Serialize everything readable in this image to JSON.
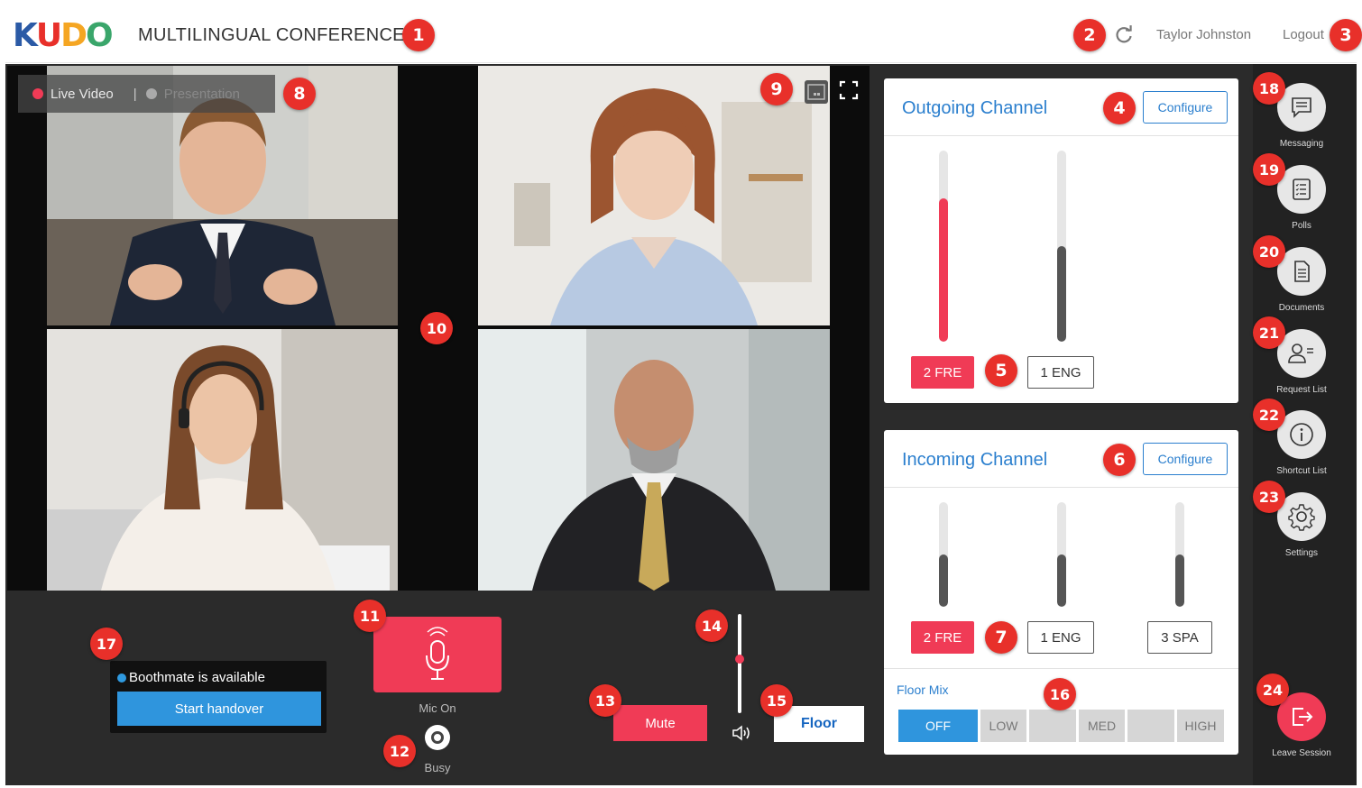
{
  "header": {
    "logo_text": "KUDO",
    "logo_colors": [
      "#2b5aa6",
      "#e8302a",
      "#f5a623",
      "#3aa66b"
    ],
    "conference_title": "MULTILINGUAL CONFERENCE",
    "user_name": "Taylor Johnston",
    "logout_label": "Logout"
  },
  "video": {
    "toggle_live": "Live Video",
    "toggle_separator": "|",
    "toggle_presentation": "Presentation"
  },
  "controls": {
    "boothmate_status": "Boothmate is available",
    "handover_label": "Start handover",
    "mic_label": "Mic On",
    "busy_label": "Busy",
    "mute_label": "Mute",
    "floor_label": "Floor",
    "volume_level": 0.55
  },
  "outgoing": {
    "title": "Outgoing Channel",
    "configure_label": "Configure",
    "channels": [
      {
        "label": "2 FRE",
        "active": true,
        "level": 0.75
      },
      {
        "label": "1 ENG",
        "active": false,
        "level": 0.5
      }
    ]
  },
  "incoming": {
    "title": "Incoming Channel",
    "configure_label": "Configure",
    "channels": [
      {
        "label": "2 FRE",
        "active": true,
        "level": 0.5
      },
      {
        "label": "1 ENG",
        "active": false,
        "level": 0.5
      },
      {
        "label": "3 SPA",
        "active": false,
        "level": 0.5
      }
    ],
    "floor_mix_label": "Floor Mix",
    "floor_mix_options": [
      "OFF",
      "LOW",
      "",
      "MED",
      "",
      "HIGH"
    ],
    "floor_mix_selected": "OFF"
  },
  "sidebar": {
    "items": [
      {
        "label": "Messaging",
        "icon": "chat-icon"
      },
      {
        "label": "Polls",
        "icon": "poll-icon"
      },
      {
        "label": "Documents",
        "icon": "document-icon"
      },
      {
        "label": "Request List",
        "icon": "request-list-icon"
      },
      {
        "label": "Shortcut List",
        "icon": "info-icon"
      },
      {
        "label": "Settings",
        "icon": "gear-icon"
      }
    ],
    "leave_label": "Leave Session"
  },
  "badges": [
    "1",
    "2",
    "3",
    "4",
    "5",
    "6",
    "7",
    "8",
    "9",
    "10",
    "11",
    "12",
    "13",
    "14",
    "15",
    "16",
    "17",
    "18",
    "19",
    "20",
    "21",
    "22",
    "23",
    "24"
  ],
  "colors": {
    "accent_red": "#f03b56",
    "accent_blue": "#2b7fce",
    "badge_red": "#e8302a",
    "dark_bg": "#2b2b2b"
  }
}
